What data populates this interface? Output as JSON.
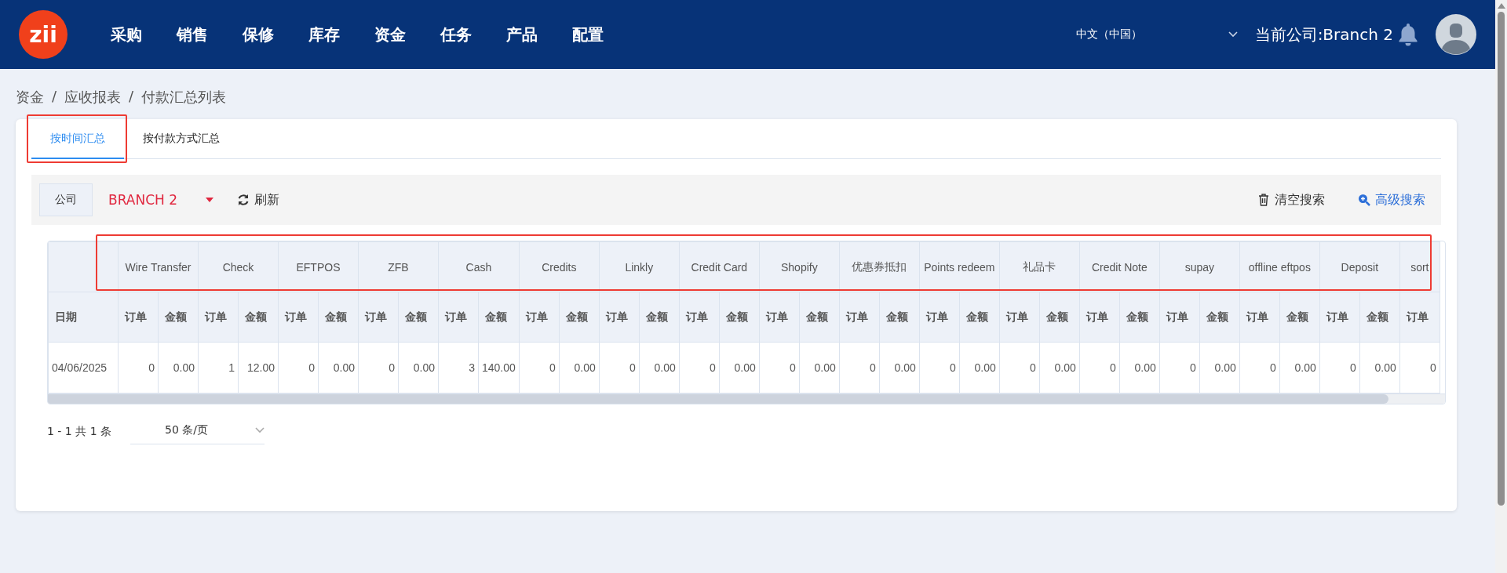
{
  "topbar": {
    "logo": "zii",
    "menu": [
      {
        "label": "采购"
      },
      {
        "label": "销售"
      },
      {
        "label": "保修"
      },
      {
        "label": "库存"
      },
      {
        "label": "资金"
      },
      {
        "label": "任务"
      },
      {
        "label": "产品"
      },
      {
        "label": "配置"
      }
    ],
    "language": "中文（中国）",
    "company": "当前公司:Branch 2"
  },
  "breadcrumb": {
    "items": [
      "资金",
      "应收报表",
      "付款汇总列表"
    ],
    "separators": [
      "/",
      "/"
    ]
  },
  "tabs": [
    {
      "label": "按时间汇总",
      "selected": true,
      "highlighted": true
    },
    {
      "label": "按付款方式汇总",
      "selected": false,
      "highlighted": false
    }
  ],
  "toolbar": {
    "company_label": "公司",
    "company_value": "BRANCH 2",
    "refresh": "刷新",
    "clear_search": "清空搜索",
    "advanced_search": "高级搜索"
  },
  "table": {
    "header_highlighted": true,
    "column_groups": [
      {
        "kind": "single"
      },
      {
        "label": "Wire Transfer",
        "kind": "pair"
      },
      {
        "label": "Check",
        "kind": "pair"
      },
      {
        "label": "EFTPOS",
        "kind": "pair"
      },
      {
        "label": "ZFB",
        "kind": "pair"
      },
      {
        "label": "Cash",
        "kind": "pair"
      },
      {
        "label": "Credits",
        "kind": "pair"
      },
      {
        "label": "Linkly",
        "kind": "pair"
      },
      {
        "label": "Credit Card",
        "kind": "pair"
      },
      {
        "label": "Shopify",
        "kind": "pair"
      },
      {
        "label": "优惠券抵扣",
        "kind": "pair"
      },
      {
        "label": "Points redeem",
        "kind": "pair"
      },
      {
        "label": "礼品卡",
        "kind": "pair"
      },
      {
        "label": "Credit Note",
        "kind": "pair"
      },
      {
        "label": "supay",
        "kind": "pair"
      },
      {
        "label": "offline eftpos",
        "kind": "pair"
      },
      {
        "label": "Deposit",
        "kind": "pair"
      },
      {
        "label": "sort",
        "kind": "single"
      }
    ],
    "columns": [
      "日期",
      "订单",
      "金额",
      "订单",
      "金额",
      "订单",
      "金额",
      "订单",
      "金额",
      "订单",
      "金额",
      "订单",
      "金额",
      "订单",
      "金额",
      "订单",
      "金额",
      "订单",
      "金额",
      "订单",
      "金额",
      "订单",
      "金额",
      "订单",
      "金额",
      "订单",
      "金额",
      "订单",
      "金额",
      "订单",
      "金额",
      "订单",
      "金额",
      "订单"
    ],
    "rows": [
      {
        "cells": [
          "04/06/2025",
          "0",
          "0.00",
          "1",
          "12.00",
          "0",
          "0.00",
          "0",
          "0.00",
          "3",
          "140.00",
          "0",
          "0.00",
          "0",
          "0.00",
          "0",
          "0.00",
          "0",
          "0.00",
          "0",
          "0.00",
          "0",
          "0.00",
          "0",
          "0.00",
          "0",
          "0.00",
          "0",
          "0.00",
          "0",
          "0.00",
          "0",
          "0.00",
          "0"
        ]
      }
    ]
  },
  "pagination": {
    "summary": "1 - 1 共 1 条",
    "page_size": "50 条/页"
  }
}
